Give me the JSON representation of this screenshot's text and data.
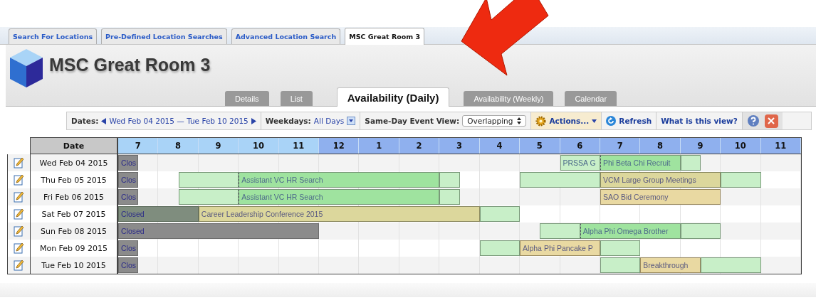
{
  "location_tabs": [
    {
      "label": "Search For Locations",
      "selected": false
    },
    {
      "label": "Pre-Defined Location Searches",
      "selected": false
    },
    {
      "label": "Advanced Location Search",
      "selected": false
    },
    {
      "label": "MSC Great Room 3",
      "selected": true
    }
  ],
  "title": "MSC Great Room 3",
  "view_tabs": [
    {
      "label": "Details",
      "selected": false
    },
    {
      "label": "List",
      "selected": false
    },
    {
      "label": "Availability (Daily)",
      "selected": true
    },
    {
      "label": "Availability (Weekly)",
      "selected": false
    },
    {
      "label": "Calendar",
      "selected": false
    }
  ],
  "toolbar": {
    "dates_label": "Dates:",
    "date_range": "Wed Feb 04 2015 — Tue Feb 10 2015",
    "weekdays_label": "Weekdays:",
    "weekdays_value": "All Days",
    "view_label": "Same-Day Event View:",
    "view_value": "Overlapping",
    "actions": "Actions...",
    "refresh": "Refresh",
    "help_link": "What is this view?"
  },
  "grid": {
    "date_header": "Date",
    "hours": [
      {
        "label": "7",
        "kind": "am"
      },
      {
        "label": "8",
        "kind": "am"
      },
      {
        "label": "9",
        "kind": "am"
      },
      {
        "label": "10",
        "kind": "am"
      },
      {
        "label": "11",
        "kind": "am"
      },
      {
        "label": "12",
        "kind": "pm"
      },
      {
        "label": "1",
        "kind": "pm"
      },
      {
        "label": "2",
        "kind": "pm"
      },
      {
        "label": "3",
        "kind": "pm"
      },
      {
        "label": "4",
        "kind": "pm"
      },
      {
        "label": "5",
        "kind": "pm"
      },
      {
        "label": "6",
        "kind": "pm"
      },
      {
        "label": "7",
        "kind": "pm"
      },
      {
        "label": "8",
        "kind": "pm"
      },
      {
        "label": "9",
        "kind": "pm"
      },
      {
        "label": "10",
        "kind": "pm"
      },
      {
        "label": "11",
        "kind": "pm"
      }
    ],
    "rows": [
      {
        "date": "Wed Feb 04 2015",
        "segments": [
          {
            "kind": "closed",
            "label": "Clos"
          },
          {
            "kind": "setup",
            "label": "PRSSA G"
          },
          {
            "kind": "event",
            "label": "Phi Beta Chi Recruit"
          },
          {
            "kind": "setup"
          }
        ]
      },
      {
        "date": "Thu Feb 05 2015",
        "segments": [
          {
            "kind": "closed",
            "label": "Clos"
          },
          {
            "kind": "setup"
          },
          {
            "kind": "event",
            "label": "Assistant VC HR Search"
          },
          {
            "kind": "setup"
          },
          {
            "kind": "setup"
          },
          {
            "kind": "booked",
            "label": "VCM Large Group Meetings"
          },
          {
            "kind": "setup"
          }
        ]
      },
      {
        "date": "Fri Feb 06 2015",
        "segments": [
          {
            "kind": "closed",
            "label": "Clos"
          },
          {
            "kind": "setup"
          },
          {
            "kind": "event",
            "label": "Assistant VC HR Search"
          },
          {
            "kind": "setup"
          },
          {
            "kind": "hold",
            "label": "SAO Bid Ceremony"
          }
        ]
      },
      {
        "date": "Sat Feb 07 2015",
        "segments": [
          {
            "kind": "overlap",
            "label": "Closed"
          },
          {
            "kind": "booked",
            "label": "Career Leadership Conference 2015"
          },
          {
            "kind": "setup"
          }
        ]
      },
      {
        "date": "Sun Feb 08 2015",
        "segments": [
          {
            "kind": "closed",
            "label": "Closed"
          },
          {
            "kind": "setup"
          },
          {
            "kind": "event",
            "label": "Alpha Phi Omega Brother"
          },
          {
            "kind": "setup"
          }
        ]
      },
      {
        "date": "Mon Feb 09 2015",
        "segments": [
          {
            "kind": "closed",
            "label": "Clos"
          },
          {
            "kind": "setup"
          },
          {
            "kind": "hold",
            "label": "Alpha Phi Pancake P"
          },
          {
            "kind": "setup"
          }
        ]
      },
      {
        "date": "Tue Feb 10 2015",
        "segments": [
          {
            "kind": "closed",
            "label": "Clos"
          },
          {
            "kind": "setup"
          },
          {
            "kind": "hold",
            "label": "Breakthrough"
          },
          {
            "kind": "setup"
          }
        ]
      }
    ]
  }
}
